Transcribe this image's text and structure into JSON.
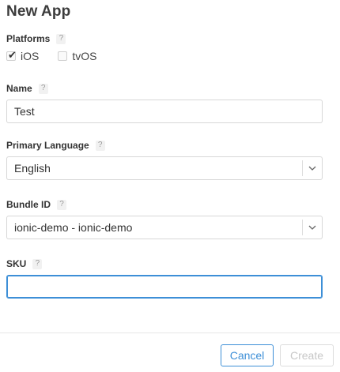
{
  "dialog": {
    "title": "New App"
  },
  "platforms": {
    "label": "Platforms",
    "help": "?",
    "options": [
      {
        "label": "iOS",
        "checked": true
      },
      {
        "label": "tvOS",
        "checked": false
      }
    ]
  },
  "name": {
    "label": "Name",
    "help": "?",
    "value": "Test"
  },
  "primary_language": {
    "label": "Primary Language",
    "help": "?",
    "value": "English"
  },
  "bundle_id": {
    "label": "Bundle ID",
    "help": "?",
    "value": "ionic-demo - ionic-demo"
  },
  "sku": {
    "label": "SKU",
    "help": "?",
    "value": ""
  },
  "buttons": {
    "cancel": "Cancel",
    "create": "Create"
  },
  "colors": {
    "accent": "#3d8fd7",
    "disabled_text": "#c7c7c7",
    "border": "#d7d7d7"
  },
  "icons": {
    "checkmark": "checkmark-icon",
    "help": "help-icon",
    "dropdown": "chevron-down-icon"
  }
}
